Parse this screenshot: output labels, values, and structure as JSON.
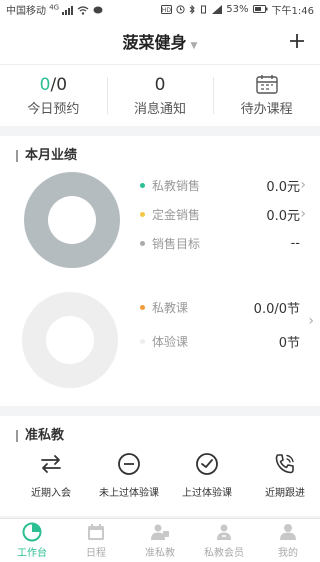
{
  "status_bar": {
    "carrier": "中国移动",
    "network": "4G",
    "battery": "53%",
    "time": "下午1:46"
  },
  "header": {
    "title": "菠菜健身",
    "add_icon": "plus-icon"
  },
  "stats": [
    {
      "value_highlight": "0",
      "value_rest": "/0",
      "label": "今日预约"
    },
    {
      "value": "0",
      "label": "消息通知"
    },
    {
      "icon": "calendar-icon",
      "label": "待办课程"
    }
  ],
  "performance": {
    "title": "本月业绩",
    "sales": [
      {
        "label": "私教销售",
        "value": "0.0元",
        "color": "#2bbf94"
      },
      {
        "label": "定金销售",
        "value": "0.0元",
        "color": "#f2c744"
      },
      {
        "label": "销售目标",
        "value": "--",
        "color": "#aaaaaa"
      }
    ],
    "lessons": [
      {
        "label": "私教课",
        "value": "0.0/0节",
        "color": "#f39a3b"
      },
      {
        "label": "体验课",
        "value": "0节",
        "color": "#eeeeee"
      }
    ]
  },
  "chart_data": [
    {
      "type": "pie",
      "categories": [
        "私教销售",
        "定金销售"
      ],
      "values": [
        0.0,
        0.0
      ],
      "unit": "元",
      "colors": [
        "#2bbf94",
        "#f2c744"
      ],
      "empty_color": "#b4bcc0"
    },
    {
      "type": "pie",
      "categories": [
        "私教课",
        "体验课"
      ],
      "values": [
        0.0,
        0
      ],
      "unit": "节",
      "colors": [
        "#f39a3b",
        "#eeeeee"
      ],
      "empty_color": "#eeeeee"
    }
  ],
  "prospects": {
    "title": "准私教",
    "actions": [
      {
        "label": "近期入会",
        "icon": "swap-arrows-icon"
      },
      {
        "label": "未上过体验课",
        "icon": "minus-circle-icon"
      },
      {
        "label": "上过体验课",
        "icon": "check-circle-icon"
      },
      {
        "label": "近期跟进",
        "icon": "phone-icon"
      }
    ]
  },
  "tabs": [
    {
      "label": "工作台",
      "icon": "dashboard-icon",
      "active": true
    },
    {
      "label": "日程",
      "icon": "calendar-icon"
    },
    {
      "label": "准私教",
      "icon": "prospect-icon"
    },
    {
      "label": "私教会员",
      "icon": "member-icon"
    },
    {
      "label": "我的",
      "icon": "profile-icon"
    }
  ]
}
